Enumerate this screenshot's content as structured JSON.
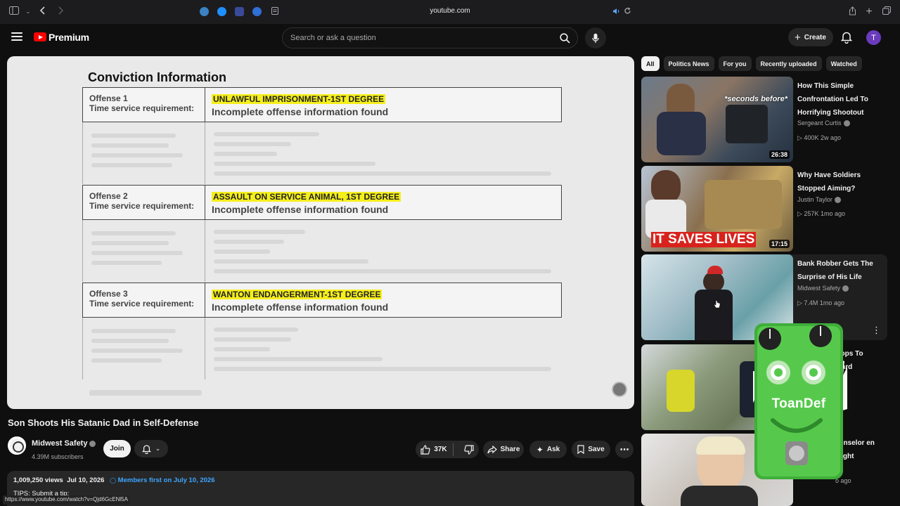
{
  "browser": {
    "url": "youtube.com"
  },
  "header": {
    "brand": "Premium",
    "search_placeholder": "Search or ask a question",
    "create_label": "Create",
    "avatar_letter": "T"
  },
  "video": {
    "doc_title": "Conviction Information",
    "offenses": [
      {
        "label": "Offense 1",
        "requirement": "Time service requirement:",
        "charge": "UNLAWFUL IMPRISONMENT-1ST DEGREE",
        "message": "Incomplete offense information found"
      },
      {
        "label": "Offense 2",
        "requirement": "Time service requirement:",
        "charge": "ASSAULT ON SERVICE ANIMAL, 1ST DEGREE",
        "message": "Incomplete offense information found"
      },
      {
        "label": "Offense 3",
        "requirement": "Time service requirement:",
        "charge": "WANTON ENDANGERMENT-1ST DEGREE",
        "message": "Incomplete offense information found"
      }
    ],
    "title": "Son Shoots His Satanic Dad in Self-Defense",
    "channel": "Midwest Safety",
    "subscribers": "4.39M subscribers",
    "join_label": "Join",
    "likes": "37K",
    "share_label": "Share",
    "ask_label": "Ask",
    "save_label": "Save",
    "views": "1,009,250 views",
    "date": "Jul 10, 2026",
    "members_text": "Members first on July 10, 2026",
    "tips": "TIPS: Submit a tip:",
    "status_url": "https://www.youtube.com/watch?v=Qjd6GcENl5A"
  },
  "chips": [
    "All",
    "Politics News",
    "For you",
    "Recently uploaded",
    "Watched"
  ],
  "recommendations": [
    {
      "title": "How This Simple Confrontation Led To Horrifying Shootout",
      "channel": "Sergeant Curtis",
      "meta": "400K  2w ago",
      "duration": "26:38",
      "overlay": "*seconds before*"
    },
    {
      "title": "Why Have Soldiers Stopped Aiming?",
      "channel": "Justin Taylor",
      "meta": "257K  1mo ago",
      "duration": "17:15",
      "overlay": "IT SAVES LIVES"
    },
    {
      "title": "Bank Robber Gets The Surprise of His Life",
      "channel": "Midwest Safety",
      "meta": "7.4M  1mo ago",
      "duration": "",
      "overlay": ""
    },
    {
      "title": "s Cops To ckyard",
      "channel": "",
      "meta": "",
      "duration": "",
      "overlay": ""
    },
    {
      "title": "Counselor en Caught",
      "channel": "",
      "meta": "o ago",
      "duration": "",
      "overlay": ""
    }
  ],
  "overlay_graphic": {
    "text": "ToanDef"
  }
}
